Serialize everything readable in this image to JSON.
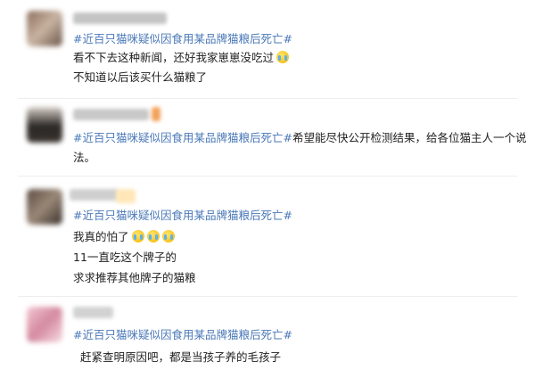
{
  "posts": [
    {
      "hashtag": "#近百只猫咪疑似因食用某品牌猫粮后死亡#",
      "lines": [
        "看不下去这种新闻，还好我家崽崽没吃过",
        "不知道以后该买什么猫粮了"
      ],
      "emoji_count": 1
    },
    {
      "hashtag": "#近百只猫咪疑似因食用某品牌猫粮后死亡#",
      "text_after_tag": "希望能尽快公开检测结果，给各位猫主人一个说",
      "lines": [
        "法。"
      ]
    },
    {
      "hashtag": "#近百只猫咪疑似因食用某品牌猫粮后死亡#",
      "lines": [
        "我真的怕了",
        "11一直吃这个牌子的",
        "求求推荐其他牌子的猫粮"
      ],
      "emoji_count": 3
    },
    {
      "hashtag": "#近百只猫咪疑似因食用某品牌猫粮后死亡#",
      "lines": [
        "赶紧查明原因吧，都是当孩子养的毛孩子"
      ]
    }
  ],
  "colors": {
    "hashtag": "#4a78b8",
    "text": "#222222",
    "emoji": "#f2b400"
  },
  "icons": [
    "crying-face-emoji"
  ]
}
